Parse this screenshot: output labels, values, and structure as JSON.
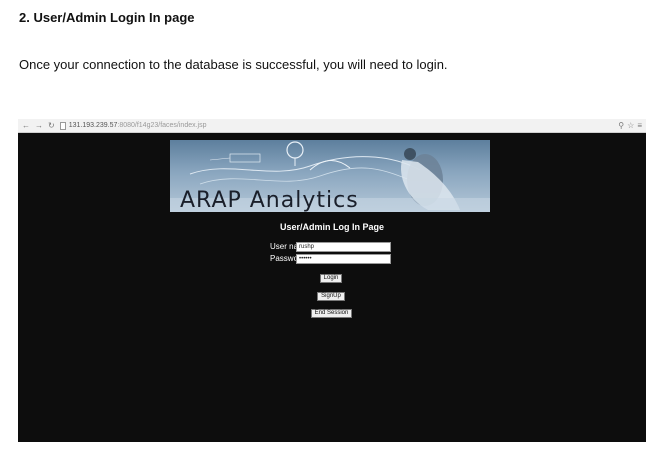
{
  "document": {
    "heading": "2. User/Admin Login In page",
    "intro": "Once your connection to the database is successful, you will need to login."
  },
  "browser": {
    "url_host": "131.193.239.57",
    "url_path": ":8080/f14g23/faces/index.jsp"
  },
  "app": {
    "banner_title": "ARAP Analytics",
    "login_title": "User/Admin Log In Page",
    "username_label": "User name",
    "username_value": "rushp",
    "password_label": "Password",
    "password_value": "••••••",
    "login_button": "Login",
    "signup_button": "SignUp",
    "end_session_button": "End Session"
  },
  "colors": {
    "screenshot_background": "#0d0d0d",
    "banner_sky": "#8aa6bf"
  }
}
